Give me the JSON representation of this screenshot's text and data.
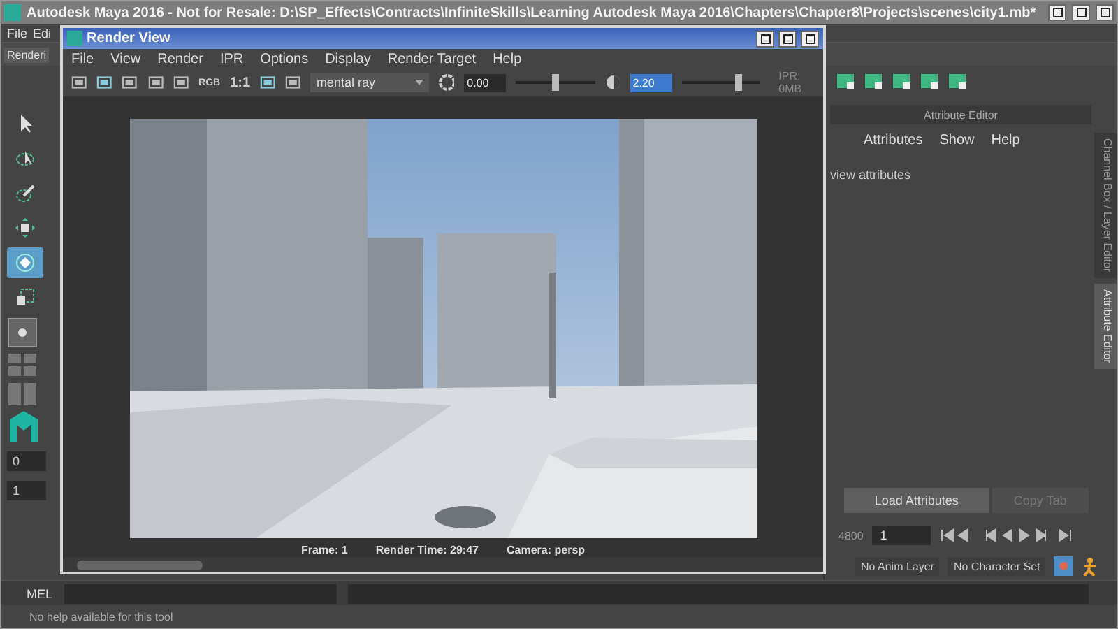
{
  "main_window": {
    "title": "Autodesk Maya 2016 - Not for Resale: D:\\SP_Effects\\Contracts\\InfiniteSkills\\Learning Autodesk Maya 2016\\Chapters\\Chapter8\\Projects\\scenes\\city1.mb*",
    "menu": [
      "File",
      "Edi"
    ],
    "shelf_tab": "Renderi"
  },
  "tools": [
    {
      "selected": false
    },
    {
      "selected": false
    },
    {
      "selected": false
    },
    {
      "selected": false
    },
    {
      "selected": true
    },
    {
      "selected": false
    }
  ],
  "left_fields": [
    "0",
    "1"
  ],
  "render_view": {
    "title": "Render View",
    "menu": [
      "File",
      "View",
      "Render",
      "IPR",
      "Options",
      "Display",
      "Render Target",
      "Help"
    ],
    "rgb": "RGB",
    "ratio": "1:1",
    "renderer": "mental ray",
    "exposure": "0.00",
    "exposure_slider": {
      "level": 0.5
    },
    "gamma": "2.20",
    "gamma_slider": {
      "level": 0.72
    },
    "ipr": "IPR: 0MB",
    "status": [
      "Frame: 1",
      "Render Time: 29:47",
      "Camera: persp"
    ]
  },
  "attribute_editor": {
    "title": "Attribute Editor",
    "menu": [
      "Attributes",
      "Show",
      "Help"
    ],
    "hint": "view attributes",
    "side_tabs": [
      {
        "label": "Channel Box / Layer Editor",
        "selected": false
      },
      {
        "label": "Attribute Editor",
        "selected": true
      }
    ],
    "buttons": [
      {
        "label": "Load Attributes",
        "disabled": false
      },
      {
        "label": "Copy Tab",
        "disabled": true
      }
    ]
  },
  "time_slider": {
    "end": "4800",
    "current": "1"
  },
  "anim_layer": "No Anim Layer",
  "character_set": "No Character Set",
  "command_line": {
    "label": "MEL"
  },
  "help_line": "No help available for this tool"
}
